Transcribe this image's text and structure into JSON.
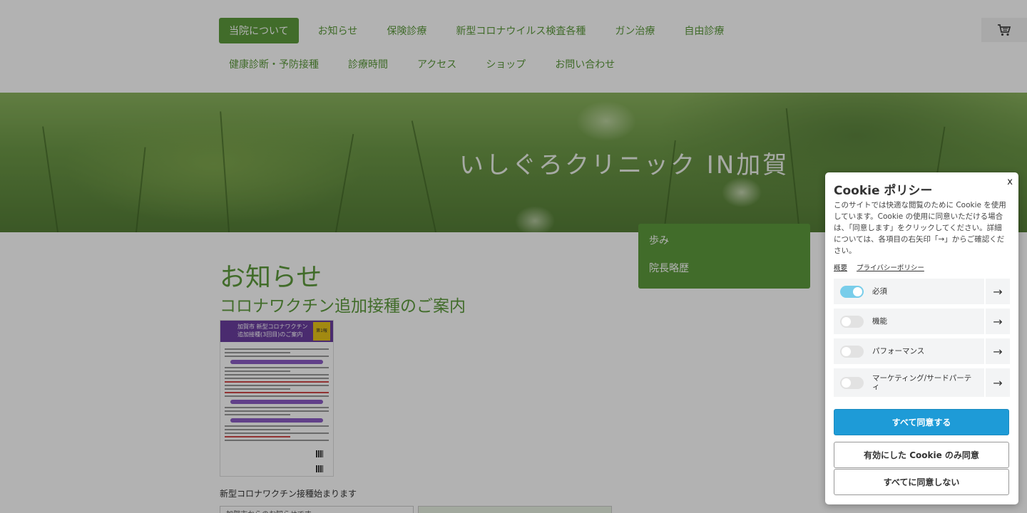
{
  "nav": {
    "row1": [
      "当院について",
      "お知らせ",
      "保険診療",
      "新型コロナウイルス検査各種",
      "ガン治療",
      "自由診療"
    ],
    "row2": [
      "健康診断・予防接種",
      "診療時間",
      "アクセス",
      "ショップ",
      "お問い合わせ"
    ],
    "active": "当院について",
    "cart_icon": "cart-icon"
  },
  "hero": {
    "title": "いしぐろクリニック IN加賀"
  },
  "dropdown": {
    "items": [
      "歩み",
      "院長略歴"
    ]
  },
  "main": {
    "page_title": "お知らせ",
    "subtitle": "コロナワクチン追加接種のご案内",
    "flyer": {
      "header_text": "加賀市 新型コロナワクチン 追加接種(3回目)のご案内",
      "badge": "第1報"
    },
    "caption": "新型コロナワクチン接種始まります",
    "table_cells": [
      "加賀市からのお知らせです",
      ""
    ]
  },
  "cookie": {
    "close_label": "x",
    "title": "Cookie ポリシー",
    "description": "このサイトでは快適な閲覧のために Cookie を使用しています。Cookie の使用に同意いただける場合は、「同意します」をクリックしてください。詳細については、各項目の右矢印「→」からご確認ください。",
    "links": [
      "概要",
      "プライバシーポリシー"
    ],
    "categories": [
      {
        "label": "必須",
        "enabled": true
      },
      {
        "label": "機能",
        "enabled": false
      },
      {
        "label": "パフォーマンス",
        "enabled": false
      },
      {
        "label": "マーケティング/サードパーティ",
        "enabled": false
      }
    ],
    "arrow": "→",
    "buttons": {
      "accept_all": "すべて同意する",
      "accept_selected": "有効にした Cookie のみ同意",
      "reject_all": "すべてに同意しない"
    }
  },
  "colors": {
    "accent_green": "#5e9b3d",
    "primary_blue": "#1e9bd7",
    "toggle_on": "#78cdea"
  }
}
